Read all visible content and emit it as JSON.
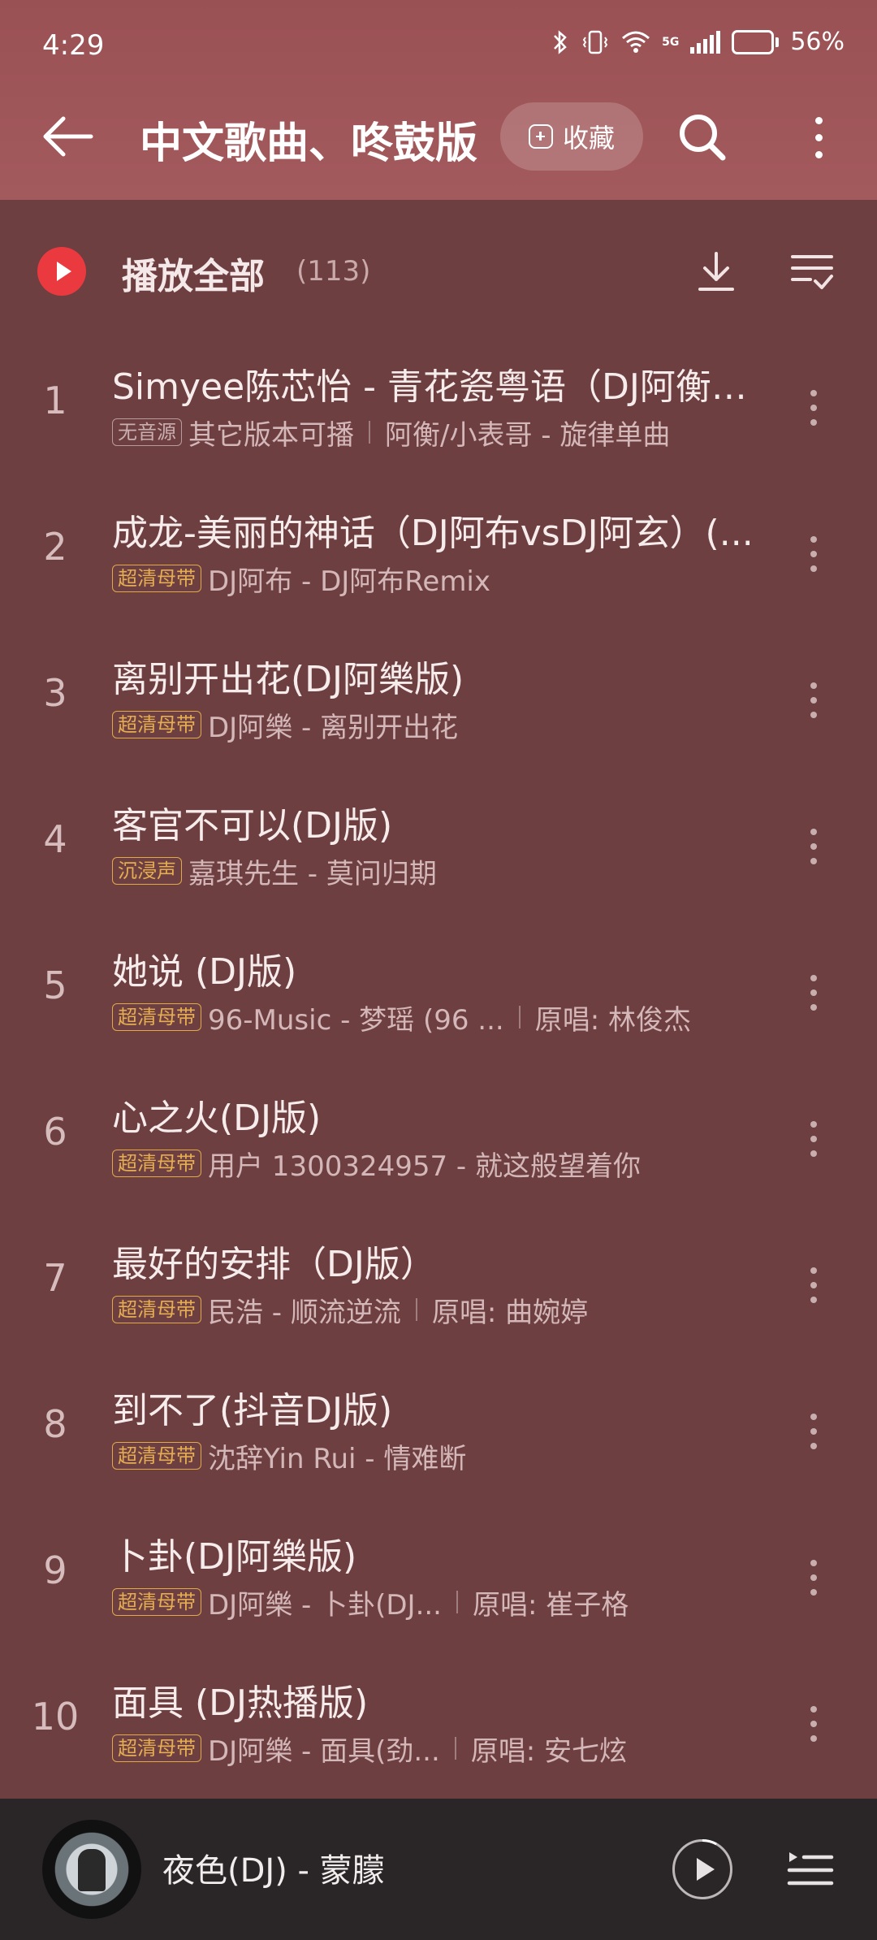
{
  "status_bar": {
    "time": "4:29",
    "network": "5G",
    "battery": "56%",
    "battery_level": 0.56
  },
  "header": {
    "title": "中文歌曲、咚鼓版",
    "collect_label": "收藏",
    "icons": [
      "back-arrow-icon",
      "search-icon",
      "more-vertical-icon"
    ]
  },
  "play_all": {
    "label": "播放全部",
    "count": "(113)"
  },
  "songs": [
    {
      "index": "1",
      "title": "Simyee陈芯怡 - 青花瓷粤语（DJ阿衡R...",
      "tag": "无音源",
      "tag_style": "gray",
      "meta": "其它版本可播",
      "meta2": "阿衡/小表哥 - 旋律单曲"
    },
    {
      "index": "2",
      "title": "成龙-美丽的神话（DJ阿布vsDJ阿玄）(...",
      "tag": "超清母带",
      "tag_style": "gold",
      "meta": "DJ阿布 - DJ阿布Remix",
      "meta2": ""
    },
    {
      "index": "3",
      "title": "离别开出花(DJ阿樂版)",
      "tag": "超清母带",
      "tag_style": "gold",
      "meta": "DJ阿樂 - 离别开出花",
      "meta2": ""
    },
    {
      "index": "4",
      "title": "客官不可以(DJ版)",
      "tag": "沉浸声",
      "tag_style": "gold",
      "meta": "嘉琪先生 - 莫问归期",
      "meta2": ""
    },
    {
      "index": "5",
      "title": "她说 (DJ版)",
      "tag": "超清母带",
      "tag_style": "gold",
      "meta": "96-Music - 梦瑶 (96 ...",
      "meta2": "原唱: 林俊杰"
    },
    {
      "index": "6",
      "title": "心之火(DJ版)",
      "tag": "超清母带",
      "tag_style": "gold",
      "meta": "用户 1300324957 - 就这般望着你",
      "meta2": ""
    },
    {
      "index": "7",
      "title": "最好的安排（DJ版）",
      "tag": "超清母带",
      "tag_style": "gold",
      "meta": "民浩 - 顺流逆流",
      "meta2": "原唱: 曲婉婷"
    },
    {
      "index": "8",
      "title": "到不了(抖音DJ版)",
      "tag": "超清母带",
      "tag_style": "gold",
      "meta": "沈辞Yin Rui - 情难断",
      "meta2": ""
    },
    {
      "index": "9",
      "title": "卜卦(DJ阿樂版)",
      "tag": "超清母带",
      "tag_style": "gold",
      "meta": "DJ阿樂 - 卜卦(DJ...",
      "meta2": "原唱: 崔子格"
    },
    {
      "index": "10",
      "title": "面具 (DJ热播版)",
      "tag": "超清母带",
      "tag_style": "gold",
      "meta": "DJ阿樂 - 面具(劲...",
      "meta2": "原唱: 安七炫"
    }
  ],
  "mini_player": {
    "now_playing": "夜色(DJ) - 蒙朦",
    "progress": 0.08
  },
  "colors": {
    "accent": "#ea3a3f",
    "header": "#9a5154",
    "panel": "#6e3f41",
    "tag_gold": "#e4ad52",
    "mini_player": "#2a2628"
  }
}
